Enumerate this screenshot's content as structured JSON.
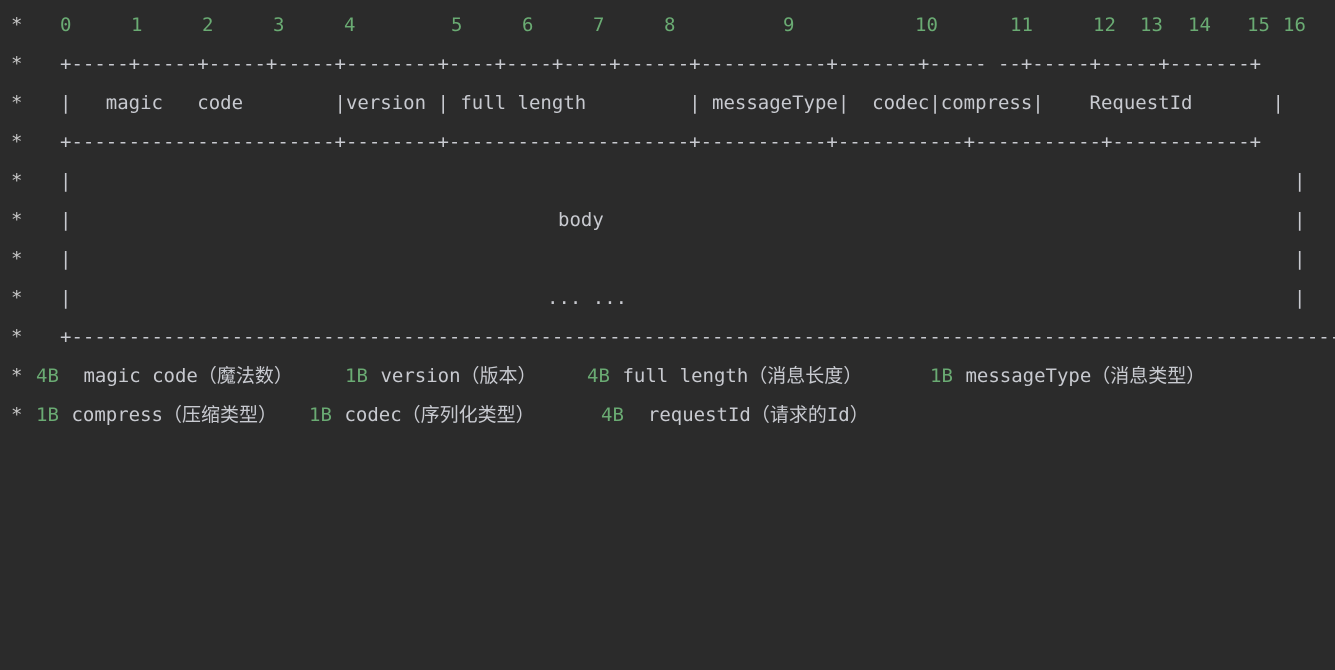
{
  "diagram": {
    "star": "*",
    "byte_ruler": [
      "0",
      "1",
      "2",
      "3",
      "4",
      "5",
      "6",
      "7",
      "8",
      "9",
      "10",
      "11",
      "12",
      "13",
      "14",
      "15",
      "16"
    ],
    "border_header": "+-----+-----+-----+-----+--------+----+----+----+------+-----------+-------+----- --+-----+-----+-------+",
    "header_row": "|   magic   code        |version | full length         | messageType|  codec|compress|    RequestId       |",
    "border_mid": "+-----------------------+--------+---------------------+-----------+-----------+-----------+------------+",
    "body_left": "|",
    "body_right": "|",
    "body_label": "body",
    "body_ellipsis": "... ...",
    "border_bottom": "+-----------------------------------------------------------------------------------------------------------------+",
    "legend": [
      [
        {
          "size": "4B",
          "text": " magic code（魔法数）"
        },
        {
          "size": "1B",
          "text": " version（版本）"
        },
        {
          "size": "4B",
          "text": " full length（消息长度）"
        },
        {
          "size": "1B",
          "text": " messageType（消息类型）"
        }
      ],
      [
        {
          "size": "1B",
          "text": " compress（压缩类型）"
        },
        {
          "size": "1B",
          "text": " codec（序列化类型）"
        },
        {
          "size": "4B",
          "text": "  requestId（请求的Id）"
        }
      ]
    ]
  }
}
